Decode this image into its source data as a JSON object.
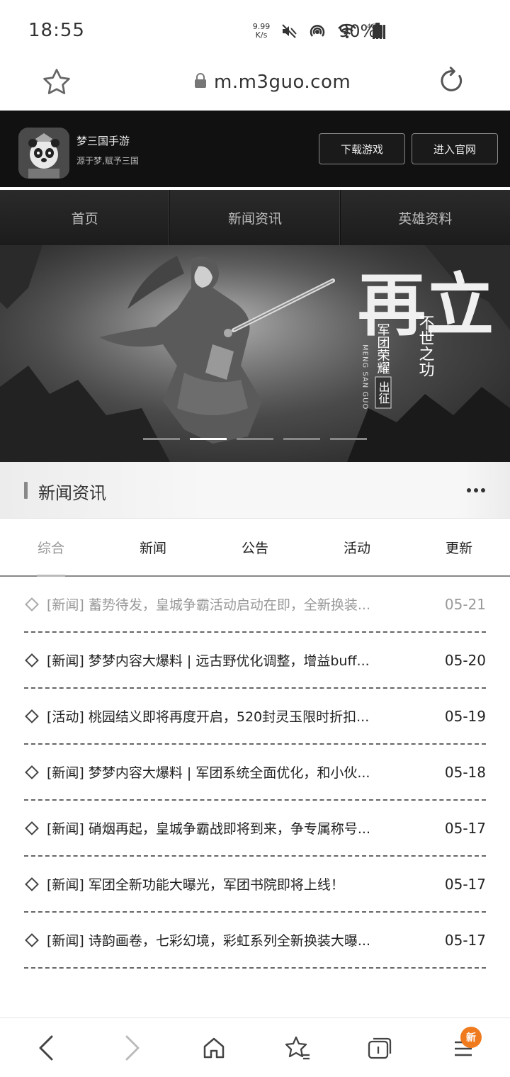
{
  "status": {
    "time": "18:55",
    "net_speed_value": "9.99",
    "net_speed_unit": "K/s",
    "network_type": "4G",
    "battery": "90%"
  },
  "browser": {
    "url": "m.m3guo.com"
  },
  "app_banner": {
    "name": "梦三国手游",
    "slogan": "源于梦,赋予三国",
    "download_label": "下载游戏",
    "official_label": "进入官网"
  },
  "nav": {
    "items": [
      {
        "label": "首页"
      },
      {
        "label": "新闻资讯"
      },
      {
        "label": "英雄资料"
      }
    ]
  },
  "hero": {
    "headline": "再立",
    "side_text": "不世之功",
    "sub_text": "军团荣耀",
    "stamp": "出征",
    "brand": "MENG SAN GUO",
    "slide_count": 5,
    "active_slide": 2
  },
  "news_section": {
    "title": "新闻资讯",
    "tabs": [
      {
        "label": "综合",
        "active": true
      },
      {
        "label": "新闻",
        "active": false
      },
      {
        "label": "公告",
        "active": false
      },
      {
        "label": "活动",
        "active": false
      },
      {
        "label": "更新",
        "active": false
      }
    ],
    "items": [
      {
        "title": "[新闻] 蓄势待发，皇城争霸活动启动在即，全新换装...",
        "date": "05-21"
      },
      {
        "title": "[新闻] 梦梦内容大爆料 | 远古野优化调整，增益buff...",
        "date": "05-20"
      },
      {
        "title": "[活动] 桃园结义即将再度开启，520封灵玉限时折扣...",
        "date": "05-19"
      },
      {
        "title": "[新闻] 梦梦内容大爆料 | 军团系统全面优化，和小伙...",
        "date": "05-18"
      },
      {
        "title": "[新闻] 硝烟再起，皇城争霸战即将到来，争专属称号...",
        "date": "05-17"
      },
      {
        "title": "[新闻] 军团全新功能大曝光，军团书院即将上线！",
        "date": "05-17"
      },
      {
        "title": "[新闻] 诗韵画卷，七彩幻境，彩虹系列全新换装大曝...",
        "date": "05-17"
      }
    ]
  },
  "toolbar": {
    "badge": "新"
  }
}
